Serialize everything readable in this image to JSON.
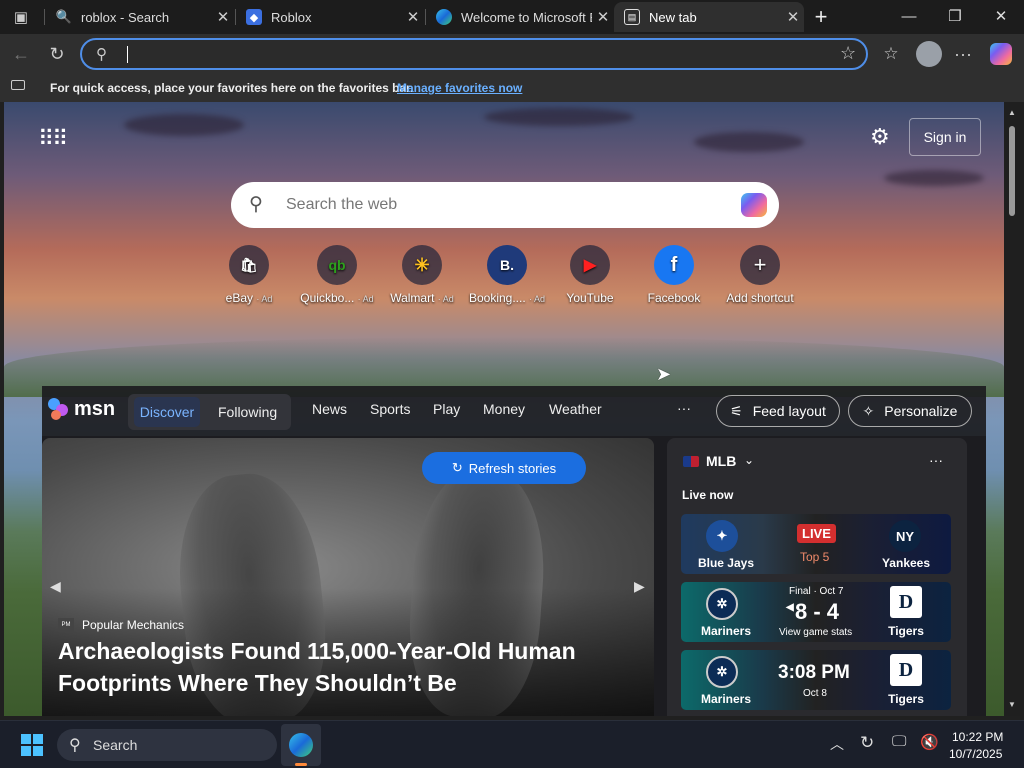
{
  "tabs": [
    {
      "title": "roblox - Search",
      "icon": "bing-search-icon"
    },
    {
      "title": "Roblox",
      "icon": "roblox-icon"
    },
    {
      "title": "Welcome to Microsoft E",
      "icon": "edge-icon"
    },
    {
      "title": "New tab",
      "icon": "new-tab-icon"
    }
  ],
  "address": {
    "value": "",
    "placeholder": ""
  },
  "favbar": {
    "text": "For quick access, place your favorites here on the favorites bar.",
    "link": "Manage favorites now"
  },
  "ntp": {
    "search_placeholder": "Search the web",
    "signin": "Sign in",
    "quick_links": [
      {
        "label": "eBay",
        "ad": "· Ad",
        "glyph": "🛍"
      },
      {
        "label": "Quickbo...",
        "ad": "· Ad",
        "glyph": "qb"
      },
      {
        "label": "Walmart",
        "ad": "· Ad",
        "glyph": "✳"
      },
      {
        "label": "Booking....",
        "ad": "· Ad",
        "glyph": "B."
      },
      {
        "label": "YouTube",
        "ad": "",
        "glyph": "▶"
      },
      {
        "label": "Facebook",
        "ad": "",
        "glyph": "f"
      },
      {
        "label": "Add shortcut",
        "ad": "",
        "glyph": "+"
      }
    ]
  },
  "msn": {
    "brand": "msn",
    "nav_active": "Discover",
    "nav_following": "Following",
    "nav": [
      "News",
      "Sports",
      "Play",
      "Money",
      "Weather"
    ],
    "more": "···",
    "feed_layout": "Feed layout",
    "personalize": "Personalize",
    "refresh": "Refresh stories",
    "hero": {
      "source": "Popular Mechanics",
      "headline_line1": "Archaeologists Found 115,000-Year-Old Human",
      "headline_line2": "Footprints Where They Shouldn’t Be"
    },
    "mlb": {
      "title": "MLB",
      "live_label": "Live now",
      "games": [
        {
          "away": "Blue Jays",
          "home": "Yankees",
          "status": "LIVE",
          "detail": "Top 5"
        },
        {
          "away": "Mariners",
          "home": "Tigers",
          "status": "Final · Oct 7",
          "score": "8 - 4",
          "detail": "View game stats"
        },
        {
          "away": "Mariners",
          "home": "Tigers",
          "time": "3:08 PM",
          "detail": "Oct 8"
        }
      ]
    }
  },
  "taskbar": {
    "search": "Search",
    "time": "10:22 PM",
    "date": "10/7/2025"
  }
}
